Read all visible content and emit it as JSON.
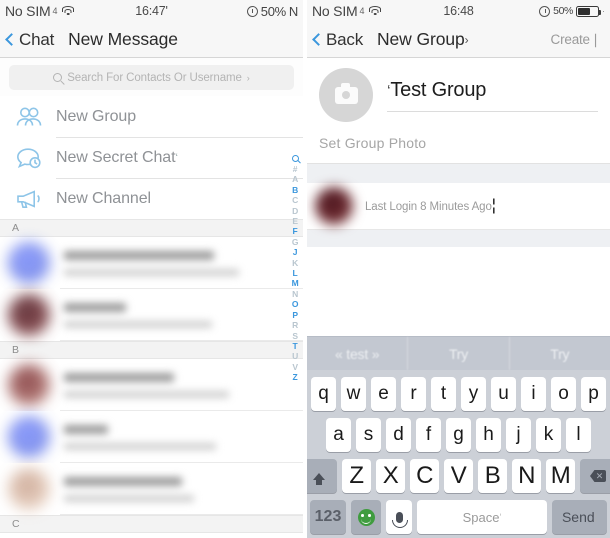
{
  "left": {
    "status": {
      "carrier": "No SIM",
      "carrier_tail": "4",
      "wifi_icon": "wifi-icon",
      "time": "16:47'",
      "alarm_icon": "alarm-icon",
      "battery_pct": "50%",
      "battery_tail": "N"
    },
    "nav": {
      "back_label": "Chat",
      "back_icon": "chevron-left-icon",
      "title": "New Message"
    },
    "search": {
      "icon": "search-icon",
      "placeholder": "Search For Contacts Or Username",
      "placeholder_tail": "›"
    },
    "actions": [
      {
        "label": "New Group",
        "icon": "group-icon",
        "tail": ""
      },
      {
        "label": "New Secret Chat",
        "icon": "secret-chat-icon",
        "tail": "‘"
      },
      {
        "label": "New Channel",
        "icon": "channel-icon",
        "tail": ""
      }
    ],
    "index": {
      "search_icon": "search-icon",
      "letters": [
        {
          "ch": "#",
          "active": false
        },
        {
          "ch": "A",
          "active": false
        },
        {
          "ch": "B",
          "active": true
        },
        {
          "ch": "C",
          "active": false
        },
        {
          "ch": "D",
          "active": false
        },
        {
          "ch": "E",
          "active": false
        },
        {
          "ch": "F",
          "active": true
        },
        {
          "ch": "G",
          "active": false
        },
        {
          "ch": "J",
          "active": true
        },
        {
          "ch": "K",
          "active": false
        },
        {
          "ch": "L",
          "active": true
        },
        {
          "ch": "M",
          "active": true
        },
        {
          "ch": "N",
          "active": false
        },
        {
          "ch": "O",
          "active": true
        },
        {
          "ch": "P",
          "active": true
        },
        {
          "ch": "R",
          "active": false
        },
        {
          "ch": "S",
          "active": false
        },
        {
          "ch": "T",
          "active": true
        },
        {
          "ch": "U",
          "active": false
        },
        {
          "ch": "V",
          "active": false
        },
        {
          "ch": "Z",
          "active": true
        }
      ]
    },
    "sections": [
      {
        "letter": "A",
        "rows": [
          {
            "avatar": "av-blue",
            "name_w": 150,
            "status_w": 175
          },
          {
            "avatar": "av-maroon",
            "name_w": 62,
            "status_w": 148
          }
        ]
      },
      {
        "letter": "B",
        "rows": [
          {
            "avatar": "av-rose",
            "name_w": 110,
            "status_w": 165
          },
          {
            "avatar": "av-blue",
            "name_w": 44,
            "status_w": 152
          },
          {
            "avatar": "av-tan",
            "name_w": 118,
            "status_w": 130
          }
        ]
      },
      {
        "letter": "C",
        "rows": []
      }
    ]
  },
  "right": {
    "status": {
      "carrier": "No SIM",
      "carrier_tail": "4",
      "wifi_icon": "wifi-icon",
      "time": "16:48",
      "time_tail": "¦",
      "alarm_icon": "alarm-icon",
      "battery_pct": "50%",
      "battery_tail": "·"
    },
    "nav": {
      "back_label": "Back",
      "back_icon": "chevron-left-icon",
      "title": "New Group",
      "title_tail": "›",
      "action_label": "Create",
      "action_tail": "❘"
    },
    "group": {
      "photo_icon": "camera-icon",
      "name_lead": "‘",
      "name_value": "Test Group",
      "set_photo_label": "Set Group Photo"
    },
    "member": {
      "status": "Last Login 8 Minutes Ago",
      "status_tail": "¦"
    },
    "keyboard": {
      "suggestions": [
        "« test »",
        "Try",
        "Try"
      ],
      "row1": [
        "q",
        "w",
        "e",
        "r",
        "t",
        "y",
        "u",
        "i",
        "o",
        "p"
      ],
      "row2": [
        "a",
        "s",
        "d",
        "f",
        "g",
        "h",
        "j",
        "k",
        "l"
      ],
      "row3": [
        "Z",
        "X",
        "C",
        "V",
        "B",
        "N",
        "M"
      ],
      "shift_icon": "shift-icon",
      "delete_icon": "backspace-icon",
      "num_label": "123",
      "emoji_icon": "emoji-icon",
      "mic_icon": "microphone-icon",
      "space_label": "Space",
      "space_tail": "‘",
      "send_label": "Send",
      "send_tail": "¦"
    }
  },
  "colors": {
    "accent_blue": "#3b97dd",
    "icon_blue": "#8ec5e8",
    "keyboard_bg": "#ccd0d7",
    "nav_bg": "#f7f7f7"
  }
}
